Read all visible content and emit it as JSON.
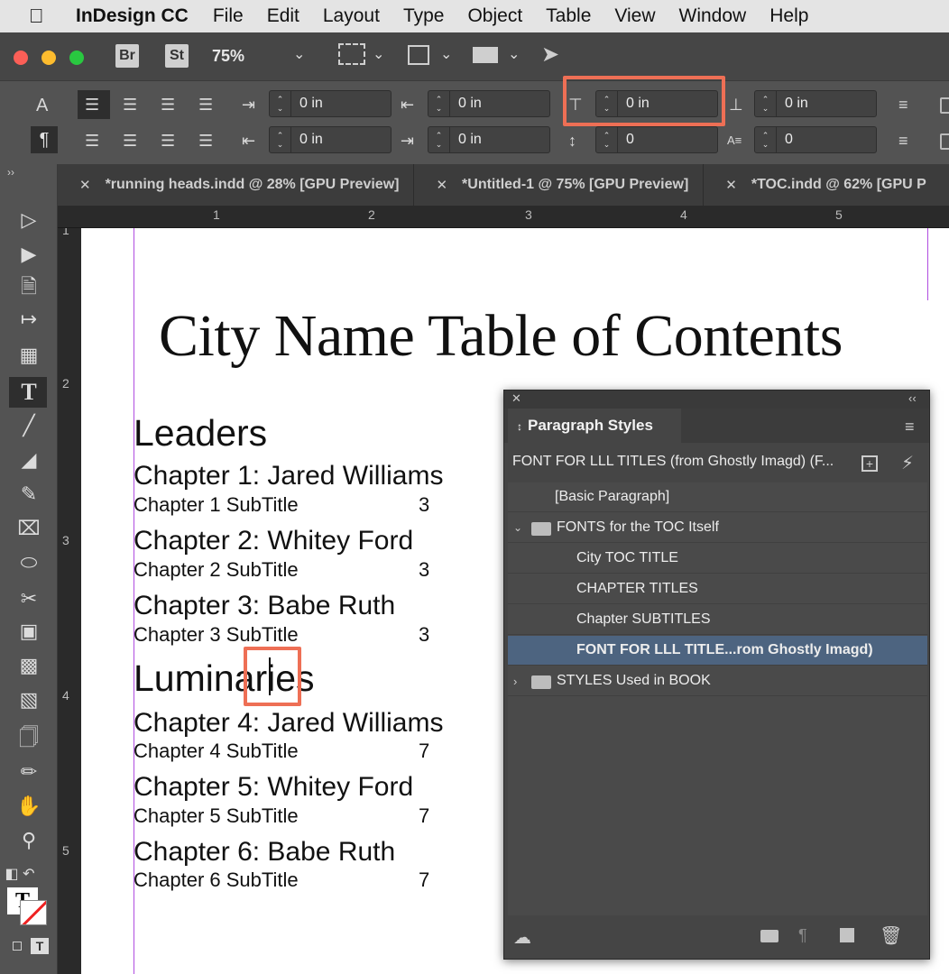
{
  "menubar": {
    "app_name": "InDesign CC",
    "items": [
      "File",
      "Edit",
      "Layout",
      "Type",
      "Object",
      "Table",
      "View",
      "Window",
      "Help"
    ]
  },
  "appbar": {
    "bridge_label": "Br",
    "stock_label": "St",
    "zoom": "75%"
  },
  "control": {
    "left_indent": "0 in",
    "right_indent": "0 in",
    "first_line_indent": "0 in",
    "last_line_indent": "0 in",
    "space_before": "0 in",
    "space_after": "0 in",
    "drop_cap_lines": "0",
    "drop_cap_chars": "0",
    "mode_char_label": "A",
    "mode_para_label": "¶"
  },
  "tabs": [
    {
      "label": "*running heads.indd @ 28% [GPU Preview]"
    },
    {
      "label": "*Untitled-1 @ 75% [GPU Preview]"
    },
    {
      "label": "*TOC.indd @ 62% [GPU P"
    }
  ],
  "rulers": {
    "h_numbers": [
      "1",
      "2",
      "3",
      "4",
      "5"
    ],
    "v_numbers": [
      "1",
      "2",
      "3",
      "4",
      "5"
    ]
  },
  "document": {
    "title": "City Name Table of Contents",
    "sections": [
      {
        "heading": "Leaders",
        "chapters": [
          {
            "title": "Chapter 1: Jared Williams",
            "subtitle": "Chapter 1 SubTitle",
            "page": "3"
          },
          {
            "title": "Chapter 2: Whitey Ford",
            "subtitle": "Chapter 2 SubTitle",
            "page": "3"
          },
          {
            "title": "Chapter 3: Babe Ruth",
            "subtitle": "Chapter 3 SubTitle",
            "page": "3"
          }
        ]
      },
      {
        "heading": "Luminaries",
        "chapters": [
          {
            "title": "Chapter 4: Jared Williams",
            "subtitle": "Chapter 4 SubTitle",
            "page": "7"
          },
          {
            "title": "Chapter 5: Whitey Ford",
            "subtitle": "Chapter 5 SubTitle",
            "page": "7"
          },
          {
            "title": "Chapter 6: Babe Ruth",
            "subtitle": "Chapter 6 SubTitle",
            "page": "7"
          }
        ]
      }
    ]
  },
  "panel": {
    "title": "Paragraph Styles",
    "current_style": "FONT FOR LLL TITLES (from Ghostly Imagd) (F...",
    "styles": [
      {
        "label": "[Basic Paragraph]"
      },
      {
        "label": "FONTS for the TOC Itself"
      },
      {
        "label": "City TOC TITLE"
      },
      {
        "label": "CHAPTER TITLES"
      },
      {
        "label": "Chapter SUBTITLES"
      },
      {
        "label": "FONT FOR LLL TITLE...rom Ghostly Imagd)"
      },
      {
        "label": "STYLES Used in BOOK"
      }
    ]
  },
  "colors": {
    "highlight": "#ee6f55",
    "selected_row": "#4d6480",
    "margin_guide": "#b04de0"
  }
}
